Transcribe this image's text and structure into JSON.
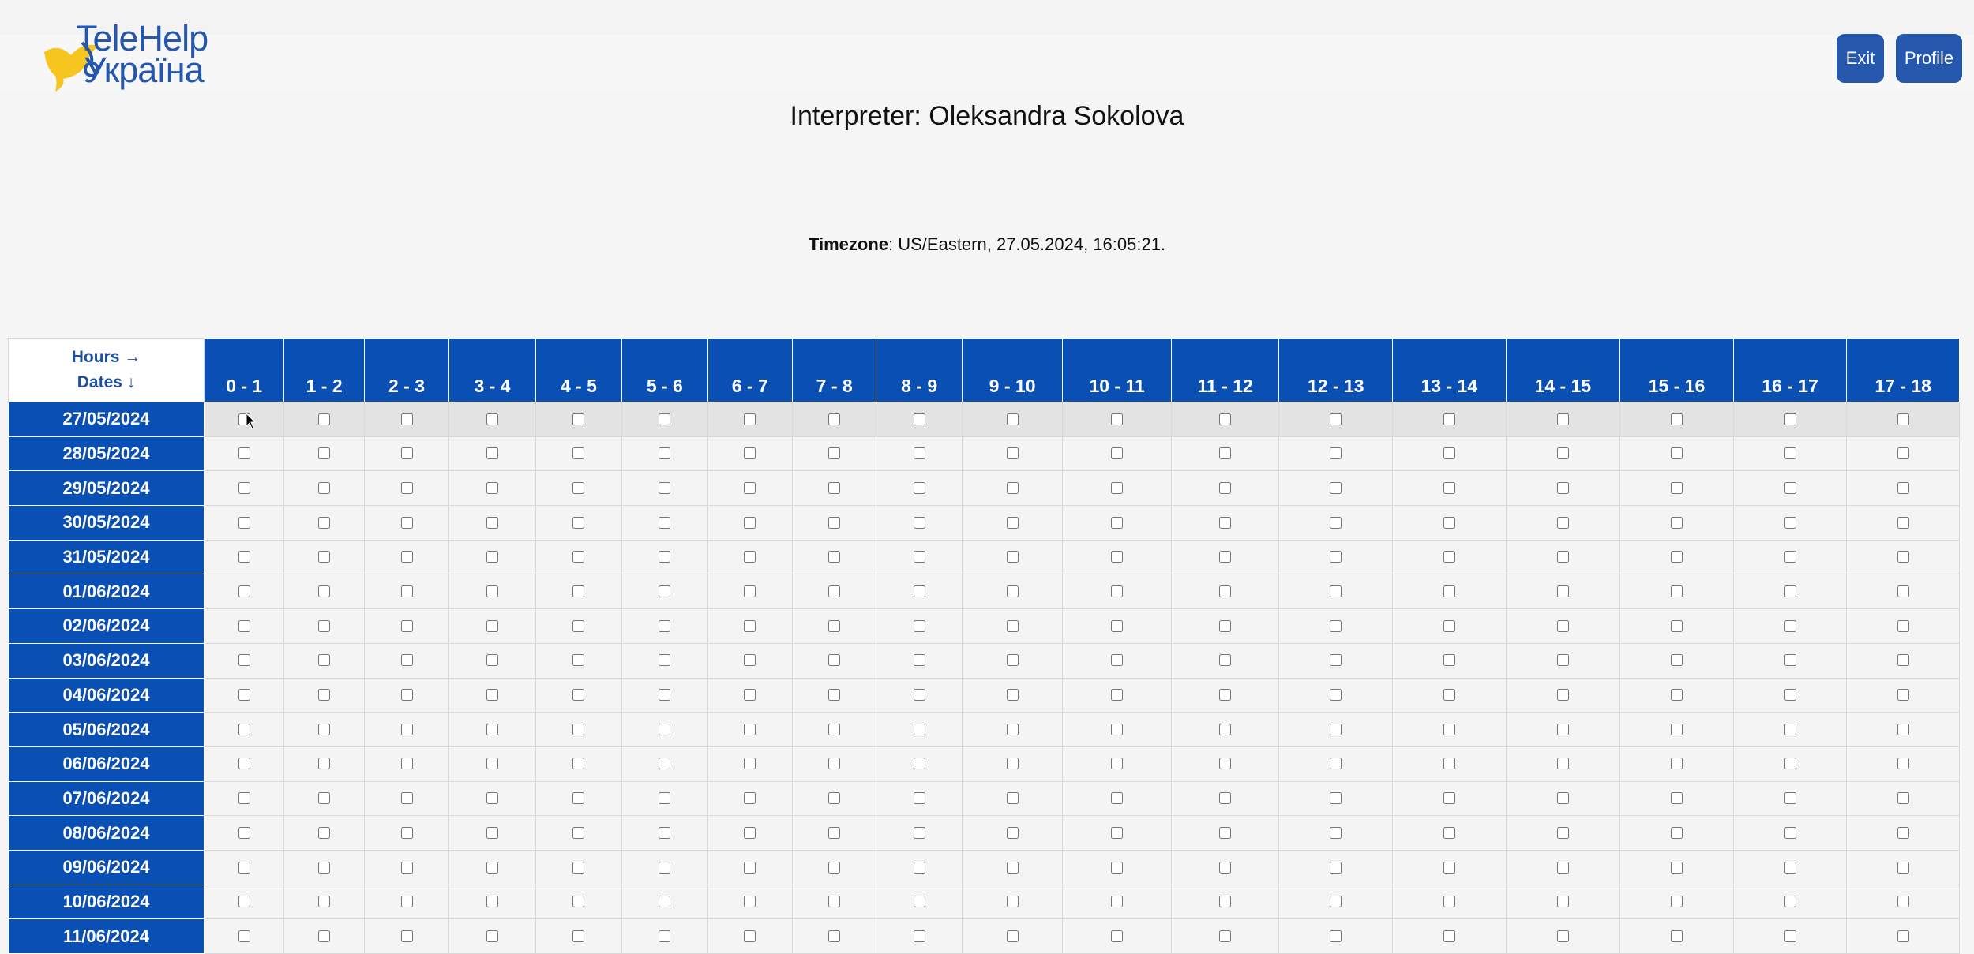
{
  "brand": {
    "line1": "TeleHelp",
    "line2": "Україна"
  },
  "header": {
    "exit_label": "Exit",
    "profile_label": "Profile"
  },
  "interpreter_line": "Interpreter: Oleksandra Sokolova",
  "timezone": {
    "label": "Timezone",
    "value": ": US/Eastern, 27.05.2024, 16:05:21."
  },
  "schedule": {
    "corner_hours": "Hours →",
    "corner_dates": "Dates ↓",
    "hours": [
      "0 - 1",
      "1 - 2",
      "2 - 3",
      "3 - 4",
      "4 - 5",
      "5 - 6",
      "6 - 7",
      "7 - 8",
      "8 - 9",
      "9 - 10",
      "10 - 11",
      "11 - 12",
      "12 - 13",
      "13 - 14",
      "14 - 15",
      "15 - 16",
      "16 - 17",
      "17 - 18"
    ],
    "dates": [
      "27/05/2024",
      "28/05/2024",
      "29/05/2024",
      "30/05/2024",
      "31/05/2024",
      "01/06/2024",
      "02/06/2024",
      "03/06/2024",
      "04/06/2024",
      "05/06/2024",
      "06/06/2024",
      "07/06/2024",
      "08/06/2024",
      "09/06/2024",
      "10/06/2024",
      "11/06/2024"
    ]
  },
  "colors": {
    "brand_blue": "#2557ad",
    "table_blue": "#0a4fb3",
    "logo_yellow": "#f7c51f"
  }
}
